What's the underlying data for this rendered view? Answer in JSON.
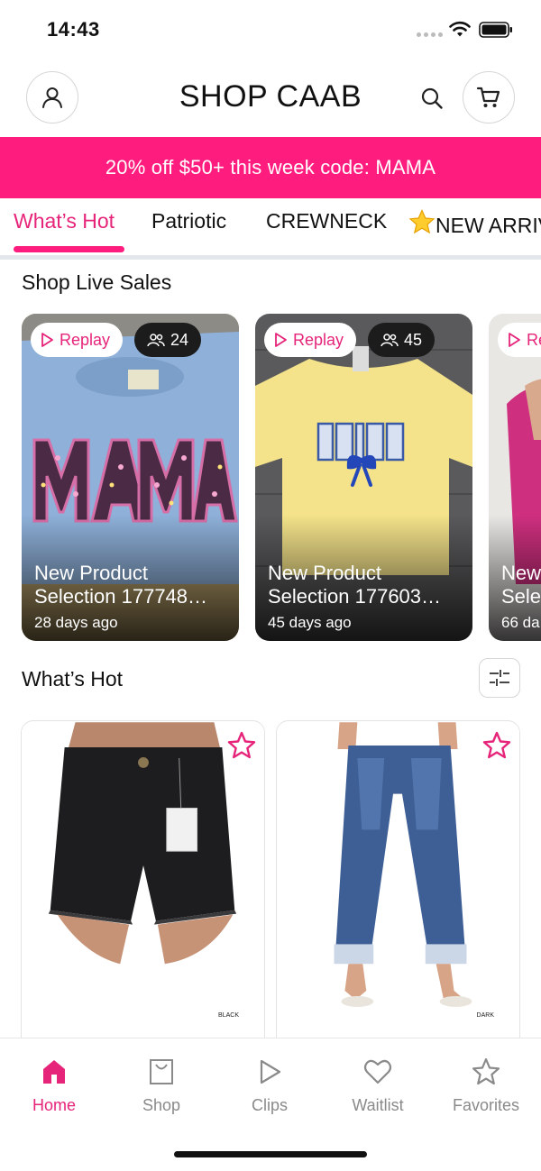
{
  "status": {
    "time": "14:43"
  },
  "header": {
    "brand": "SHOP CAAB"
  },
  "promo": {
    "text": "20% off $50+ this week code: MAMA"
  },
  "tabs": [
    {
      "label": "What’s Hot",
      "active": true
    },
    {
      "label": "Patriotic"
    },
    {
      "label": "CREWNECK"
    },
    {
      "label": "NEW ARRIV",
      "icon": "star-emoji"
    }
  ],
  "live_sales": {
    "title": "Shop Live Sales",
    "cards": [
      {
        "replay": "Replay",
        "viewers": "24",
        "title_line1": "New Product",
        "title_line2": "Selection 177748…",
        "age": "28 days ago"
      },
      {
        "replay": "Replay",
        "viewers": "45",
        "title_line1": "New Product",
        "title_line2": "Selection 177603…",
        "age": "45 days ago"
      },
      {
        "replay": "Re",
        "viewers": "",
        "title_line1": "New",
        "title_line2": "Sele",
        "age": "66 da"
      }
    ]
  },
  "whats_hot": {
    "title": "What’s Hot",
    "products": [
      {
        "image": "black denim shorts",
        "tag": "BLACK"
      },
      {
        "image": "blue cuffed jeans",
        "tag": "DARK"
      }
    ]
  },
  "bottom_nav": [
    {
      "label": "Home",
      "icon": "home-icon",
      "active": true
    },
    {
      "label": "Shop",
      "icon": "shopping-bag-icon"
    },
    {
      "label": "Clips",
      "icon": "play-icon"
    },
    {
      "label": "Waitlist",
      "icon": "heart-icon"
    },
    {
      "label": "Favorites",
      "icon": "star-icon"
    }
  ],
  "colors": {
    "accent": "#ff1c7f",
    "accent_text": "#e6247a",
    "inactive": "#8a8a8a"
  }
}
